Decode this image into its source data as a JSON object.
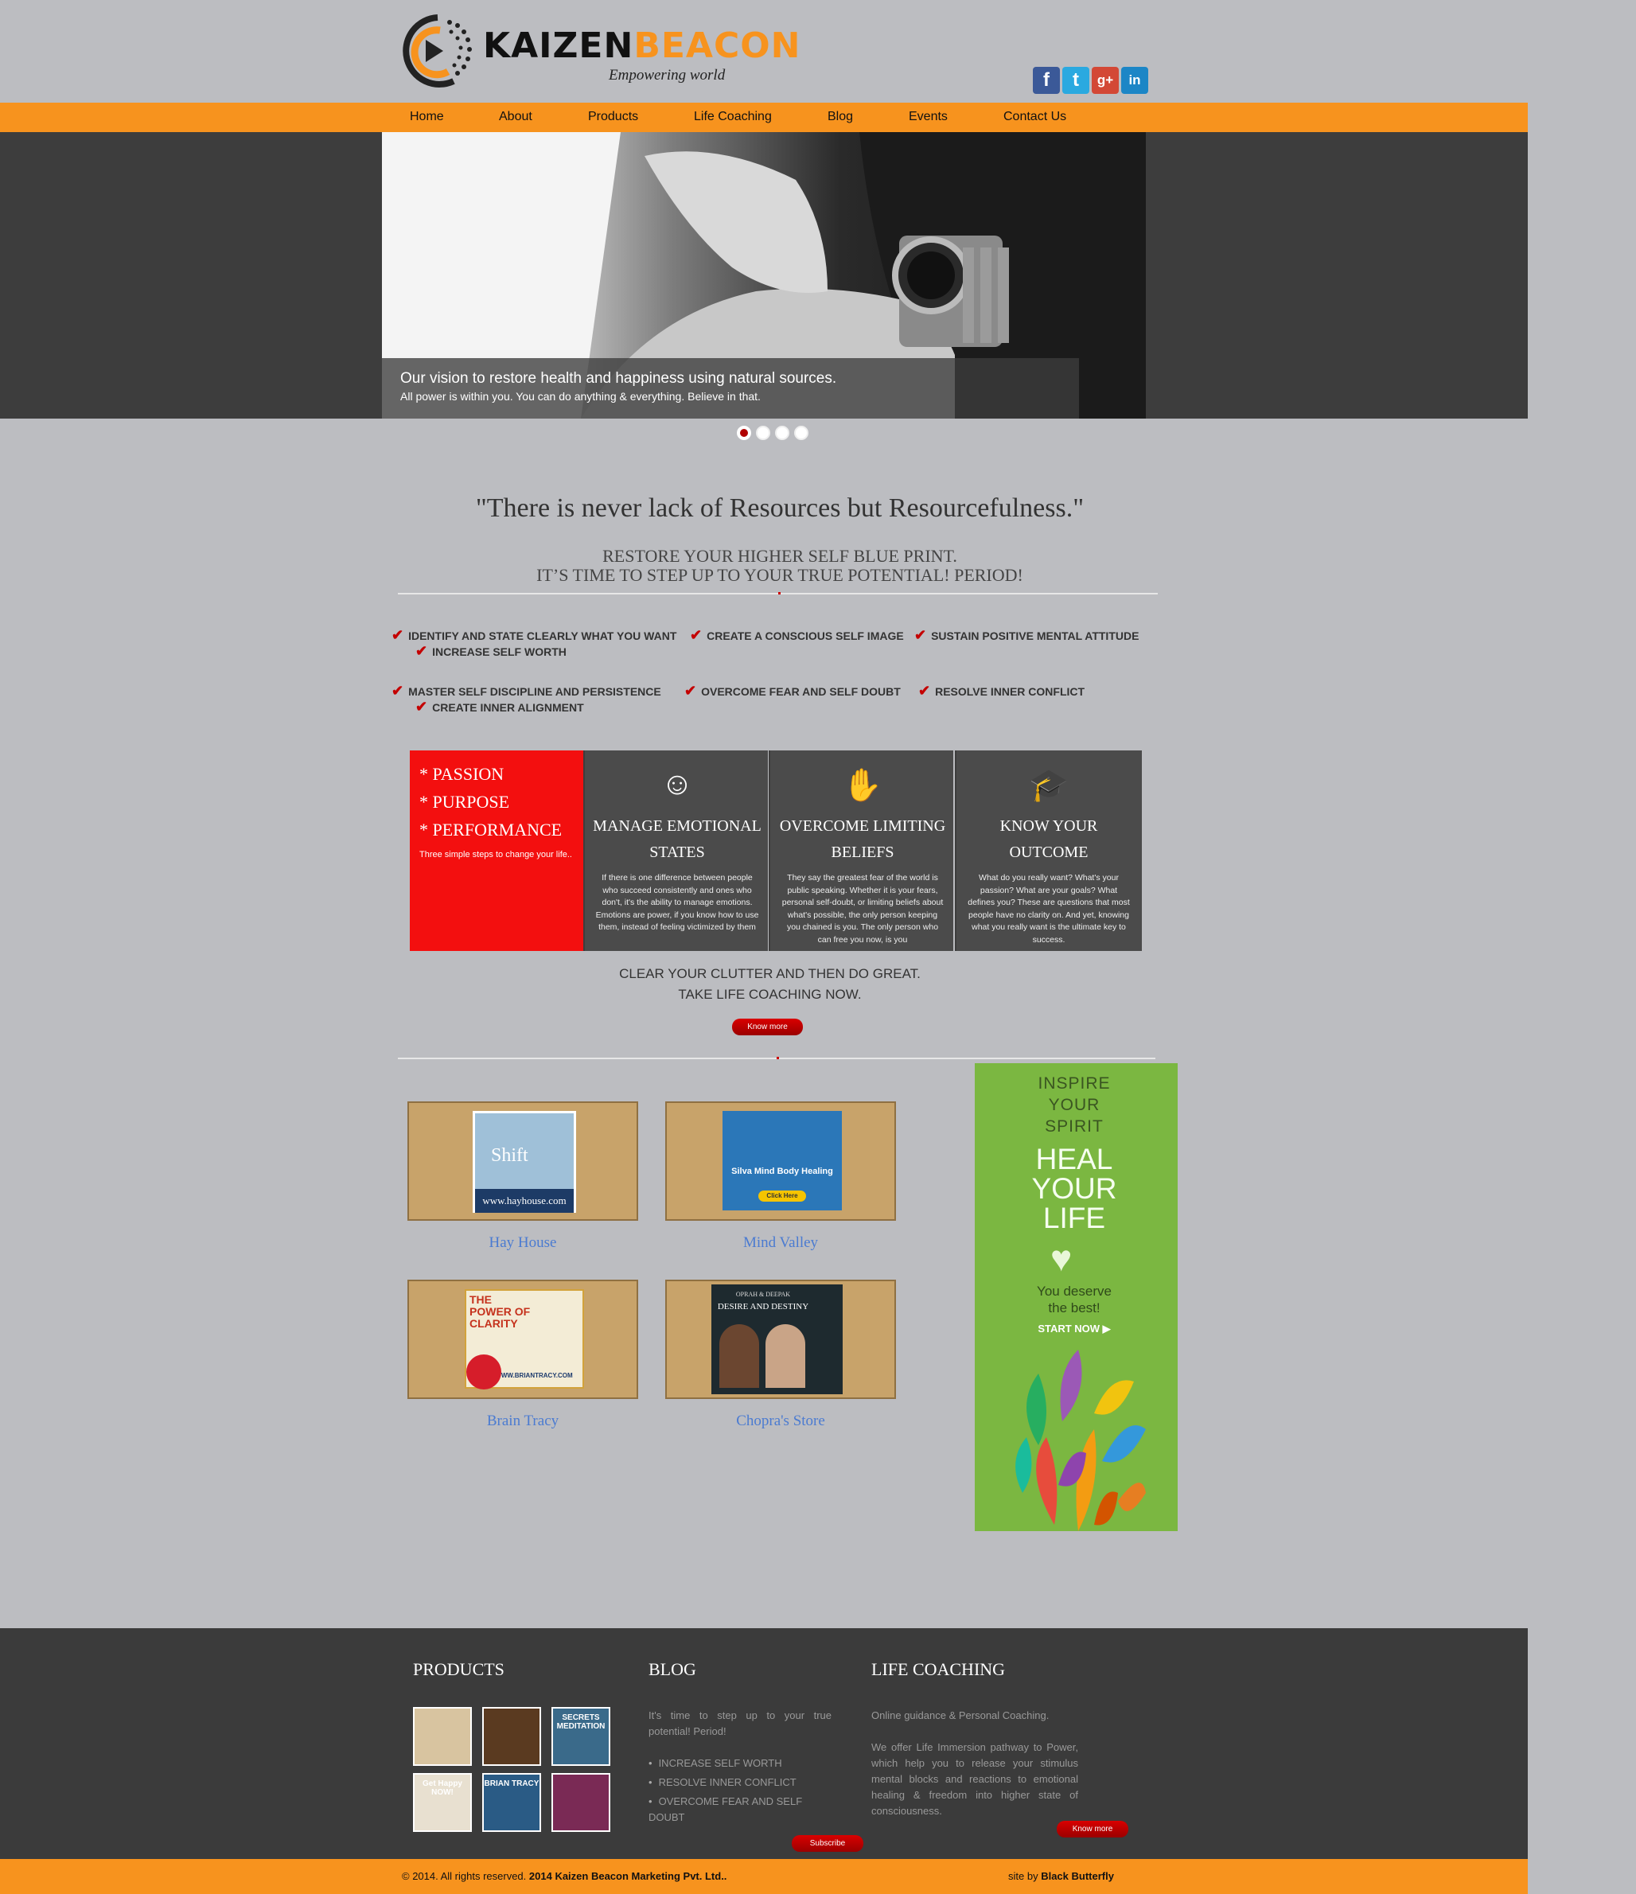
{
  "brand": {
    "name_left": "KAIZEN",
    "name_right": "BEACON",
    "tagline": "Empowering world"
  },
  "social": [
    {
      "icon": "facebook-icon",
      "glyph": "f",
      "color": "#3b5998"
    },
    {
      "icon": "twitter-icon",
      "glyph": "t",
      "color": "#2aa9e0"
    },
    {
      "icon": "google-plus-icon",
      "glyph": "g+",
      "color": "#d34836"
    },
    {
      "icon": "linkedin-icon",
      "glyph": "in",
      "color": "#1c86c6"
    }
  ],
  "nav": [
    "Home",
    "About",
    "Products",
    "Life Coaching",
    "Blog",
    "Events",
    "Contact Us"
  ],
  "hero": {
    "title": "Our vision to restore health and happiness using natural sources.",
    "subtitle": "All power is within you. You can do anything & everything. Believe in that.",
    "slides": 4,
    "active_slide": 1
  },
  "quote": "\"There is never lack of Resources but Resourcefulness.\"",
  "restore_lines": [
    "RESTORE YOUR HIGHER SELF BLUE PRINT.",
    "IT’S TIME TO STEP UP TO YOUR TRUE POTENTIAL! PERIOD!"
  ],
  "checks": [
    "IDENTIFY AND STATE CLEARLY WHAT YOU WANT",
    "CREATE A CONSCIOUS SELF IMAGE",
    "SUSTAIN POSITIVE MENTAL ATTITUDE",
    "INCREASE SELF WORTH",
    "MASTER SELF DISCIPLINE AND PERSISTENCE",
    "OVERCOME FEAR AND SELF DOUBT",
    "RESOLVE INNER CONFLICT",
    "CREATE INNER ALIGNMENT"
  ],
  "pillars": {
    "items": [
      "* PASSION",
      "* PURPOSE",
      "* PERFORMANCE"
    ],
    "sub": "Three simple steps to change your life.."
  },
  "boxes": [
    {
      "icon": "theater-masks-icon",
      "title_l1": "MANAGE EMOTIONAL",
      "title_l2": "STATES",
      "text": "If there is one difference between people who succeed consistently and ones who don't, it's the ability to manage emotions. Emotions are power, if you know how to use them, instead of feeling victimized by them"
    },
    {
      "icon": "handshake-icon",
      "title_l1": "OVERCOME LIMITING",
      "title_l2": "BELIEFS",
      "text": "They say the greatest fear of the world is public speaking. Whether it is your fears, personal self-doubt, or limiting beliefs about what's possible, the only person keeping you chained is you. The only person who can free you now, is you"
    },
    {
      "icon": "graduation-cap-icon",
      "title_l1": "KNOW YOUR",
      "title_l2": "OUTCOME",
      "text": "What do you really want? What's your passion? What are your goals? What defines you? These are questions that most people have no clarity on. And yet, knowing what you really want is the ultimate key to success."
    }
  ],
  "cta": {
    "line1": "CLEAR YOUR CLUTTER AND THEN DO GREAT.",
    "line2": "TAKE LIFE COACHING NOW.",
    "button": "Know more"
  },
  "products": [
    {
      "label": "Hay House",
      "art": "www.hayhouse.com",
      "art_title": "Shift"
    },
    {
      "label": "Mind Valley",
      "art": "Silva Mind Body Healing",
      "art_title": "Click Here"
    },
    {
      "label": "Brain Tracy",
      "art": "THE POWER OF CLARITY",
      "art_title": "WWW.BRIANTRACY.COM"
    },
    {
      "label": "Chopra's Store",
      "art": "DESIRE AND DESTINY",
      "art_title": "OPRAH & DEEPAK"
    }
  ],
  "ad": {
    "line1": "INSPIRE",
    "line2": "YOUR",
    "line3": "SPIRIT",
    "big1": "HEAL",
    "big2": "YOUR",
    "big3": "LIFE",
    "sub1": "You deserve",
    "sub2": "the best!",
    "cta": "START NOW ▶"
  },
  "footer": {
    "products_title": "PRODUCTS",
    "blog_title": "BLOG",
    "blog_intro": "It's time to step up to your true potential! Period!",
    "blog_list": [
      "INCREASE SELF WORTH",
      "RESOLVE INNER CONFLICT",
      "OVERCOME FEAR AND SELF DOUBT"
    ],
    "subscribe": "Subscribe",
    "coaching_title": "LIFE COACHING",
    "coaching_intro": "Online guidance & Personal Coaching.",
    "coaching_text": "We offer Life Immersion pathway to Power, which help you to release your stimulus mental blocks and reactions to emotional healing & freedom into higher state of consciousness.",
    "know_more": "Know more",
    "thumbs": [
      {
        "color": "#d8c4a0",
        "text": ""
      },
      {
        "color": "#5a3a20",
        "text": ""
      },
      {
        "color": "#3a6a8a",
        "text": "SECRETS MEDITATION"
      },
      {
        "color": "#e8e0d0",
        "text": "Get Happy NOW!"
      },
      {
        "color": "#2a5b85",
        "text": "BRIAN TRACY"
      },
      {
        "color": "#7a2a55",
        "text": ""
      }
    ]
  },
  "bottom": {
    "copyright": "© 2014. All rights reserved.",
    "company": "2014 Kaizen Beacon Marketing Pvt. Ltd..",
    "site_by": "site by",
    "author": "Black Butterfly"
  },
  "colors": {
    "accent": "#f7931e",
    "red": "#f30f0f",
    "dark": "#4b4b4b",
    "link": "#4b7bd1"
  }
}
